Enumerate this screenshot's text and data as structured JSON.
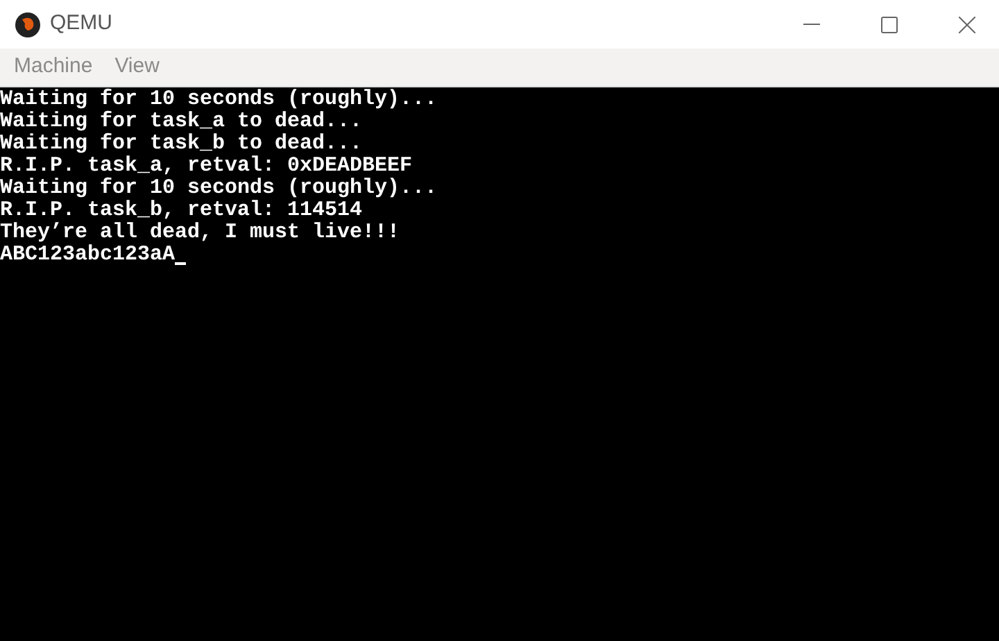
{
  "window": {
    "title": "QEMU"
  },
  "menu": [
    "Machine",
    "View"
  ],
  "console": {
    "lines": [
      "Waiting for 10 seconds (roughly)...",
      "Waiting for task_a to dead...",
      "Waiting for task_b to dead...",
      "R.I.P. task_a, retval: 0xDEADBEEF",
      "Waiting for 10 seconds (roughly)...",
      "R.I.P. task_b, retval: 114514",
      "They’re all dead, I must live!!!",
      "ABC123abc123aA"
    ]
  }
}
